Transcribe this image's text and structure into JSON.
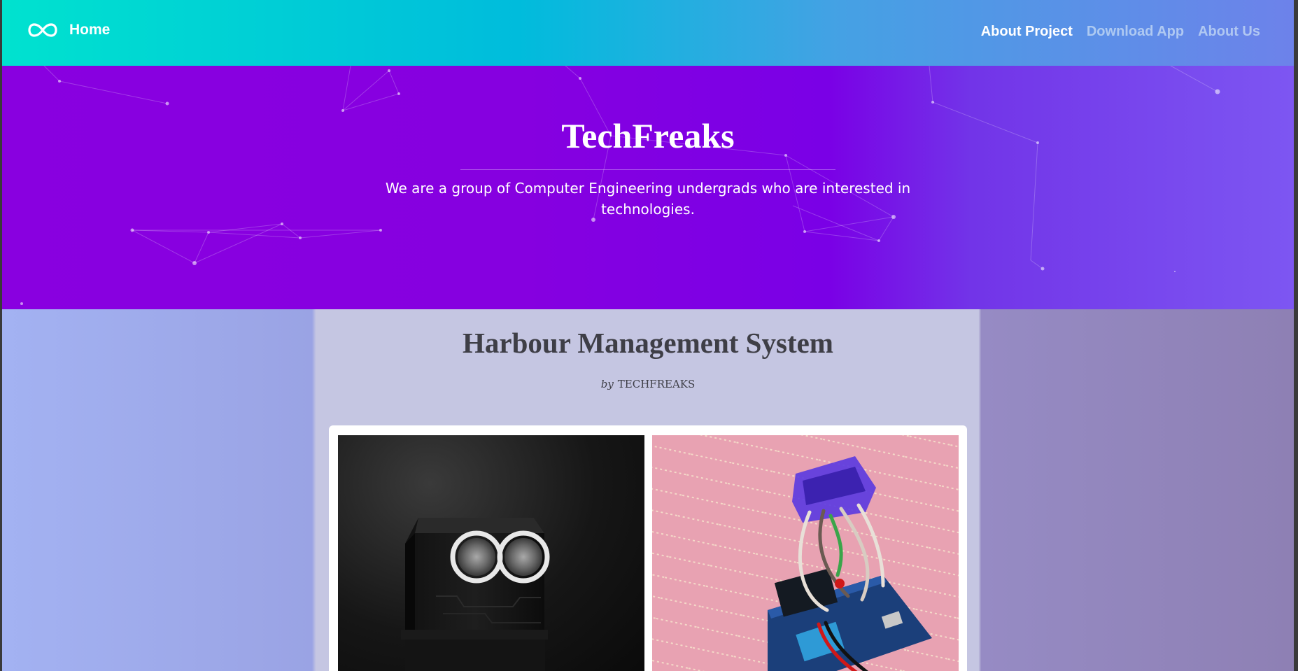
{
  "navbar": {
    "logo_icon": "infinity-icon",
    "home_label": "Home",
    "links": [
      {
        "label": "About Project",
        "active": true
      },
      {
        "label": "Download App",
        "active": false
      },
      {
        "label": "About Us",
        "active": false
      }
    ]
  },
  "hero": {
    "title": "TechFreaks",
    "description": "We are a group of Computer Engineering undergrads who are interested in technologies."
  },
  "article": {
    "title": "Harbour Management System",
    "byline_prefix": "by",
    "author": "TECHFREAKS"
  },
  "gallery": {
    "images": [
      {
        "subject": "ultrasonic-sensor-robot-photo"
      },
      {
        "subject": "arduino-circuit-board-photo"
      }
    ]
  },
  "colors": {
    "navbar_start": "#00e2cf",
    "navbar_end": "#6d82ea",
    "hero_purple": "#8600e0",
    "hero_end": "#7d56f2",
    "text_dark": "#3e3e46"
  }
}
